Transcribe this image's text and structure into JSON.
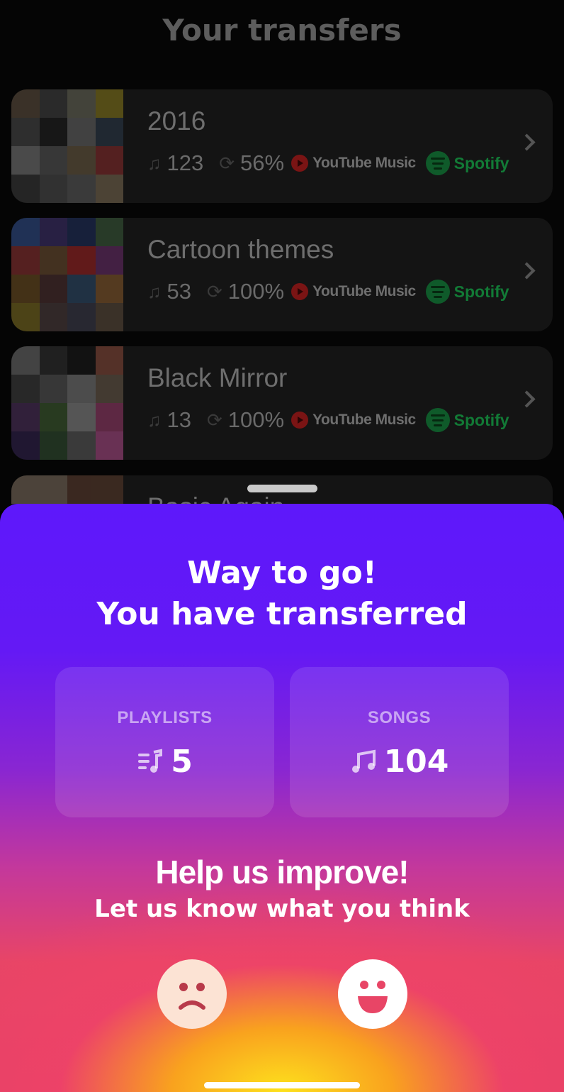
{
  "header": {
    "title": "Your transfers"
  },
  "transfers": [
    {
      "name": "2016",
      "songs": "123",
      "progress": "56%",
      "source": "YouTube Music",
      "target": "Spotify"
    },
    {
      "name": "Cartoon themes",
      "songs": "53",
      "progress": "100%",
      "source": "YouTube Music",
      "target": "Spotify"
    },
    {
      "name": "Black Mirror",
      "songs": "13",
      "progress": "100%",
      "source": "YouTube Music",
      "target": "Spotify"
    },
    {
      "name": "Basic Again"
    }
  ],
  "sheet": {
    "title_line1": "Way to go!",
    "title_line2": "You have transferred",
    "playlists_label": "PLAYLISTS",
    "playlists_value": "5",
    "songs_label": "SONGS",
    "songs_value": "104",
    "help_title": "Help us improve!",
    "help_subtitle": "Let us know what you think",
    "feedback_options": [
      "sad-face-icon",
      "happy-face-icon"
    ]
  },
  "colors": {
    "accent_purple": "#5e18fb",
    "accent_pink": "#e84566",
    "accent_yellow": "#fde11d",
    "spotify_green": "#127a36",
    "youtube_red": "#7a1414"
  }
}
